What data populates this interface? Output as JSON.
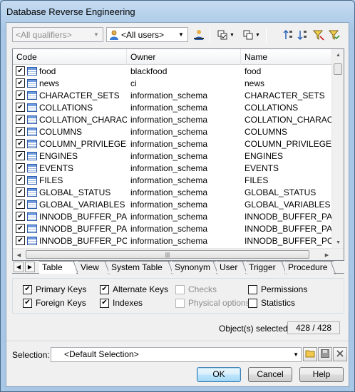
{
  "window": {
    "title": "Database Reverse Engineering"
  },
  "toolbar": {
    "qualifiers": "<All qualifiers>",
    "users": "<All users>",
    "icons": [
      "user-filter-icon",
      "select-all-icon",
      "deselect-icon",
      "sort-icon",
      "filter-icon"
    ]
  },
  "list": {
    "columns": [
      "Code",
      "Owner",
      "Name"
    ],
    "rows": [
      {
        "code": "food",
        "owner": "blackfood",
        "name": "food",
        "checked": true
      },
      {
        "code": "news",
        "owner": "ci",
        "name": "news",
        "checked": true
      },
      {
        "code": "CHARACTER_SETS",
        "owner": "information_schema",
        "name": "CHARACTER_SETS",
        "checked": true
      },
      {
        "code": "COLLATIONS",
        "owner": "information_schema",
        "name": "COLLATIONS",
        "checked": true
      },
      {
        "code": "COLLATION_CHARAC...",
        "owner": "information_schema",
        "name": "COLLATION_CHARACTE",
        "checked": true
      },
      {
        "code": "COLUMNS",
        "owner": "information_schema",
        "name": "COLUMNS",
        "checked": true
      },
      {
        "code": "COLUMN_PRIVILEGES",
        "owner": "information_schema",
        "name": "COLUMN_PRIVILEGES",
        "checked": true
      },
      {
        "code": "ENGINES",
        "owner": "information_schema",
        "name": "ENGINES",
        "checked": true
      },
      {
        "code": "EVENTS",
        "owner": "information_schema",
        "name": "EVENTS",
        "checked": true
      },
      {
        "code": "FILES",
        "owner": "information_schema",
        "name": "FILES",
        "checked": true
      },
      {
        "code": "GLOBAL_STATUS",
        "owner": "information_schema",
        "name": "GLOBAL_STATUS",
        "checked": true
      },
      {
        "code": "GLOBAL_VARIABLES",
        "owner": "information_schema",
        "name": "GLOBAL_VARIABLES",
        "checked": true
      },
      {
        "code": "INNODB_BUFFER_PA...",
        "owner": "information_schema",
        "name": "INNODB_BUFFER_PAGE",
        "checked": true
      },
      {
        "code": "INNODB_BUFFER_PA...",
        "owner": "information_schema",
        "name": "INNODB_BUFFER_PAGE",
        "checked": true
      },
      {
        "code": "INNODB_BUFFER_PO...",
        "owner": "information_schema",
        "name": "INNODB_BUFFER_POOI",
        "checked": true
      }
    ]
  },
  "tabs": [
    "Table",
    "View",
    "System Table",
    "Synonym",
    "User",
    "Trigger",
    "Procedure"
  ],
  "options": {
    "primary_keys": "Primary Keys",
    "alternate_keys": "Alternate Keys",
    "checks": "Checks",
    "permissions": "Permissions",
    "foreign_keys": "Foreign Keys",
    "indexes": "Indexes",
    "physical_options": "Physical options",
    "statistics": "Statistics"
  },
  "status": {
    "selected_label": "Object(s) selected:",
    "selected_value": "428 / 428"
  },
  "selection": {
    "label": "Selection:",
    "value": "<Default Selection>"
  },
  "buttons": {
    "ok": "OK",
    "cancel": "Cancel",
    "help": "Help"
  }
}
